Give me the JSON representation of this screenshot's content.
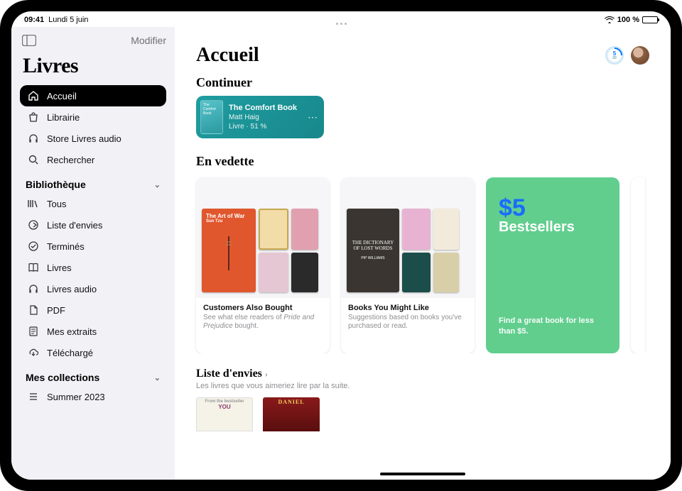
{
  "status": {
    "time": "09:41",
    "date": "Lundi 5 juin",
    "battery_pct": "100 %"
  },
  "sidebar": {
    "edit": "Modifier",
    "app_title": "Livres",
    "nav": [
      {
        "label": "Accueil"
      },
      {
        "label": "Librairie"
      },
      {
        "label": "Store Livres audio"
      },
      {
        "label": "Rechercher"
      }
    ],
    "library_header": "Bibliothèque",
    "library": [
      {
        "label": "Tous"
      },
      {
        "label": "Liste d'envies"
      },
      {
        "label": "Terminés"
      },
      {
        "label": "Livres"
      },
      {
        "label": "Livres audio"
      },
      {
        "label": "PDF"
      },
      {
        "label": "Mes extraits"
      },
      {
        "label": "Téléchargé"
      }
    ],
    "collections_header": "Mes collections",
    "collections": [
      {
        "label": "Summer 2023"
      }
    ]
  },
  "main": {
    "title": "Accueil",
    "goal": {
      "value": "5",
      "of": "20"
    },
    "continuer": {
      "header": "Continuer",
      "book_title": "The Comfort Book",
      "author": "Matt Haig",
      "progress": "Livre · 51 %"
    },
    "featured": {
      "header": "En vedette",
      "cards": [
        {
          "title": "Customers Also Bought",
          "sub_pre": "See what else readers of ",
          "sub_em": "Pride and Prejudice",
          "sub_post": " bought."
        },
        {
          "title": "Books You Might Like",
          "sub": "Suggestions based on books you've purchased or read."
        }
      ],
      "promo": {
        "price": "$5",
        "title": "Bestsellers",
        "sub": "Find a great book for less than $5."
      }
    },
    "wishlist": {
      "header": "Liste d'envies",
      "sub": "Les livres que vous aimeriez lire par la suite."
    },
    "covers": {
      "art_of_war": "The Art of War",
      "art_of_war_author": "Sun Tzu",
      "dict_lost": "THE DICTIONARY OF LOST WORDS",
      "dict_author": "PIP WILLIAMS",
      "daniel": "DANIEL",
      "you_could": "YOU"
    }
  }
}
